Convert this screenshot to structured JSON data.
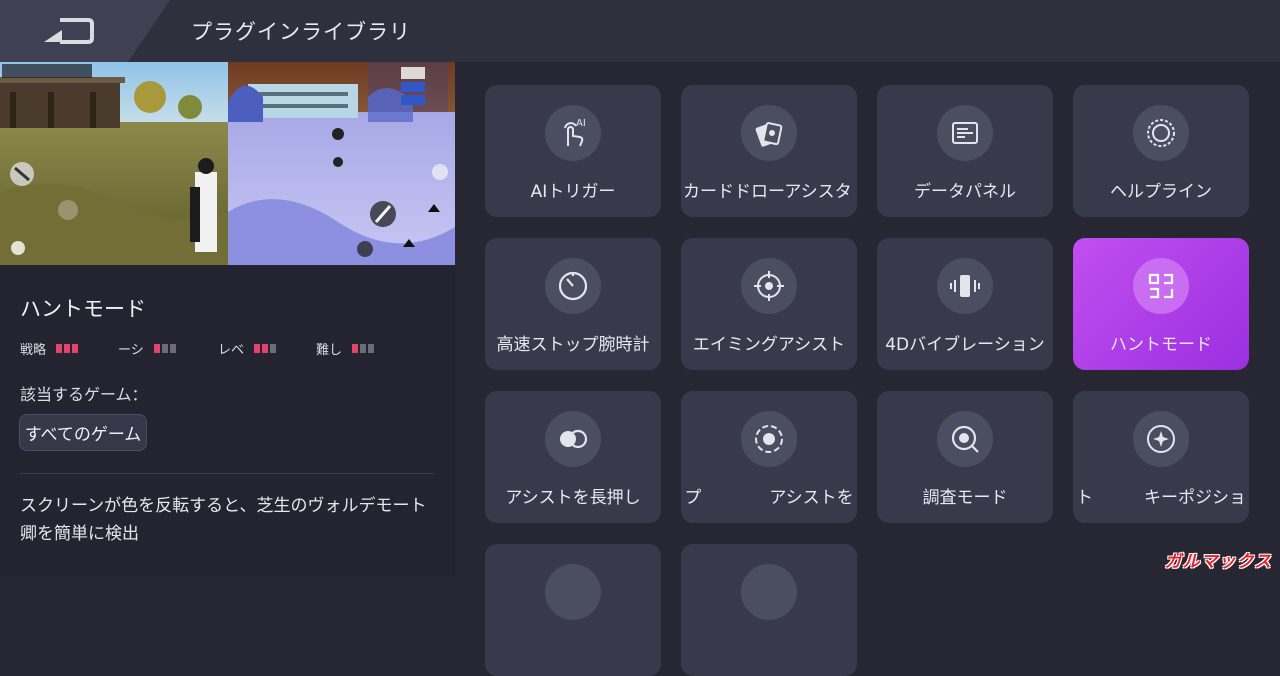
{
  "header": {
    "title": "プラグインライブラリ"
  },
  "selected_plugin": {
    "title": "ハントモード",
    "stats": [
      {
        "label": "戦略",
        "level": 3,
        "max": 3
      },
      {
        "label": "ーシ",
        "level": 1,
        "max": 3
      },
      {
        "label": "レベ",
        "level": 2,
        "max": 3
      },
      {
        "label": "難し",
        "level": 1,
        "max": 3
      }
    ],
    "games_label": "該当するゲーム：",
    "games_chip": "すべてのゲーム",
    "description": "スクリーンが色を反転すると、芝生のヴォルデモート卿を簡単に検出"
  },
  "plugins": [
    {
      "label": "AIトリガー",
      "icon": "ai-touch-icon",
      "active": false
    },
    {
      "label": "カードドローアシスタ",
      "icon": "card-draw-icon",
      "active": false
    },
    {
      "label": "データパネル",
      "icon": "data-panel-icon",
      "active": false
    },
    {
      "label": "ヘルプライン",
      "icon": "help-line-icon",
      "active": false
    },
    {
      "label": "高速ストップ腕時計",
      "icon": "stopwatch-icon",
      "active": false
    },
    {
      "label": "エイミングアシスト",
      "icon": "crosshair-icon",
      "active": false
    },
    {
      "label": "4Dバイブレーション",
      "icon": "vibration-icon",
      "active": false
    },
    {
      "label": "ハントモード",
      "icon": "hunt-mode-icon",
      "active": true
    },
    {
      "label": "アシストを長押し",
      "icon": "long-press-icon",
      "active": false
    },
    {
      "label": "プ　　　　アシストを",
      "icon": "target-assist-icon",
      "active": false
    },
    {
      "label": "調査モード",
      "icon": "investigation-icon",
      "active": false
    },
    {
      "label": "ト　　　キーポジショ",
      "icon": "key-position-icon",
      "active": false
    },
    {
      "label": "",
      "icon": "",
      "active": false
    },
    {
      "label": "",
      "icon": "",
      "active": false
    }
  ],
  "colors": {
    "accent": "#b23ff0",
    "stat_on": "#e0436b"
  },
  "watermark": "ガルマックス"
}
